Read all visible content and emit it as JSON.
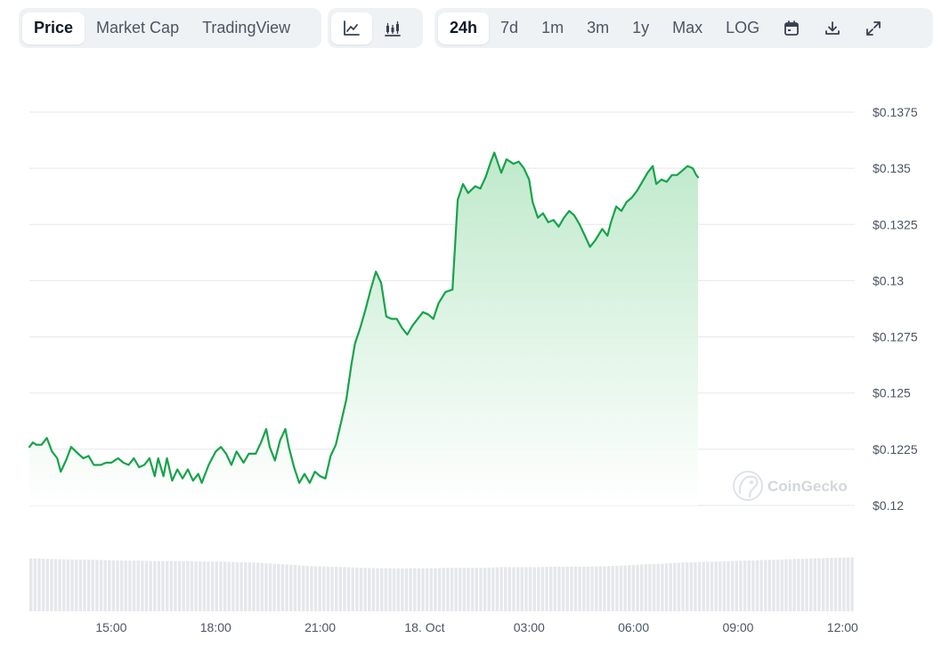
{
  "toolbar": {
    "view_tabs": [
      {
        "label": "Price",
        "active": true
      },
      {
        "label": "Market Cap",
        "active": false
      },
      {
        "label": "TradingView",
        "active": false
      }
    ],
    "chart_type_icons": [
      "line-chart-icon",
      "candlestick-chart-icon"
    ],
    "range_tabs": [
      {
        "label": "24h",
        "active": true
      },
      {
        "label": "7d",
        "active": false
      },
      {
        "label": "1m",
        "active": false
      },
      {
        "label": "3m",
        "active": false
      },
      {
        "label": "1y",
        "active": false
      },
      {
        "label": "Max",
        "active": false
      },
      {
        "label": "LOG",
        "active": false
      }
    ],
    "action_icons": [
      "calendar-icon",
      "download-icon",
      "expand-icon"
    ]
  },
  "watermark": "CoinGecko",
  "colors": {
    "line": "#16a34a",
    "fill_top": "#bbe8c8",
    "fill_bottom": "#ffffff",
    "grid": "#e5e7eb",
    "volume": "#e5e7eb"
  },
  "chart_data": {
    "type": "area",
    "x_unit": "hours since 12:00 (17 Oct)",
    "xlim": [
      0.65,
      24.35
    ],
    "ylim": [
      0.12,
      0.1375
    ],
    "y_ticks": [
      0.12,
      0.1225,
      0.125,
      0.1275,
      0.13,
      0.1325,
      0.135,
      0.1375
    ],
    "y_tick_labels": [
      "$0.12",
      "$0.1225",
      "$0.125",
      "$0.1275",
      "$0.13",
      "$0.1325",
      "$0.135",
      "$0.1375"
    ],
    "x_ticks": [
      3,
      6,
      9,
      12,
      15,
      18,
      21,
      24
    ],
    "x_tick_labels": [
      "15:00",
      "18:00",
      "21:00",
      "18. Oct",
      "03:00",
      "06:00",
      "09:00",
      "12:00"
    ],
    "grid": true,
    "series": [
      {
        "name": "",
        "points": [
          [
            0.65,
            0.1226
          ],
          [
            0.75,
            0.1228
          ],
          [
            0.85,
            0.1227
          ],
          [
            1.0,
            0.1227
          ],
          [
            1.15,
            0.123
          ],
          [
            1.3,
            0.1224
          ],
          [
            1.45,
            0.1221
          ],
          [
            1.55,
            0.1215
          ],
          [
            1.7,
            0.122
          ],
          [
            1.85,
            0.1226
          ],
          [
            2.05,
            0.1223
          ],
          [
            2.2,
            0.1221
          ],
          [
            2.35,
            0.1222
          ],
          [
            2.5,
            0.1218
          ],
          [
            2.7,
            0.1218
          ],
          [
            2.85,
            0.1219
          ],
          [
            3.0,
            0.1219
          ],
          [
            3.2,
            0.1221
          ],
          [
            3.35,
            0.1219
          ],
          [
            3.5,
            0.1218
          ],
          [
            3.65,
            0.1221
          ],
          [
            3.8,
            0.1217
          ],
          [
            3.95,
            0.1218
          ],
          [
            4.1,
            0.1221
          ],
          [
            4.25,
            0.1213
          ],
          [
            4.35,
            0.1221
          ],
          [
            4.5,
            0.1213
          ],
          [
            4.6,
            0.1221
          ],
          [
            4.75,
            0.1211
          ],
          [
            4.9,
            0.1216
          ],
          [
            5.05,
            0.1212
          ],
          [
            5.2,
            0.1216
          ],
          [
            5.35,
            0.1211
          ],
          [
            5.5,
            0.1214
          ],
          [
            5.6,
            0.121
          ],
          [
            5.8,
            0.1218
          ],
          [
            6.0,
            0.1224
          ],
          [
            6.15,
            0.1226
          ],
          [
            6.3,
            0.1223
          ],
          [
            6.45,
            0.1218
          ],
          [
            6.6,
            0.1224
          ],
          [
            6.8,
            0.1219
          ],
          [
            6.95,
            0.1223
          ],
          [
            7.15,
            0.1223
          ],
          [
            7.3,
            0.1228
          ],
          [
            7.45,
            0.1234
          ],
          [
            7.55,
            0.1226
          ],
          [
            7.7,
            0.122
          ],
          [
            7.85,
            0.1229
          ],
          [
            8.0,
            0.1234
          ],
          [
            8.1,
            0.1226
          ],
          [
            8.25,
            0.1217
          ],
          [
            8.4,
            0.121
          ],
          [
            8.55,
            0.1214
          ],
          [
            8.7,
            0.121
          ],
          [
            8.85,
            0.1215
          ],
          [
            9.0,
            0.1213
          ],
          [
            9.15,
            0.1212
          ],
          [
            9.3,
            0.1222
          ],
          [
            9.45,
            0.1227
          ],
          [
            9.6,
            0.1237
          ],
          [
            9.75,
            0.1247
          ],
          [
            9.9,
            0.1263
          ],
          [
            10.0,
            0.1272
          ],
          [
            10.15,
            0.1279
          ],
          [
            10.3,
            0.1287
          ],
          [
            10.45,
            0.1296
          ],
          [
            10.6,
            0.1304
          ],
          [
            10.75,
            0.1299
          ],
          [
            10.9,
            0.1284
          ],
          [
            11.05,
            0.1283
          ],
          [
            11.2,
            0.1283
          ],
          [
            11.35,
            0.1279
          ],
          [
            11.5,
            0.1276
          ],
          [
            11.65,
            0.128
          ],
          [
            11.8,
            0.1283
          ],
          [
            11.95,
            0.1286
          ],
          [
            12.1,
            0.1285
          ],
          [
            12.25,
            0.1283
          ],
          [
            12.4,
            0.129
          ],
          [
            12.6,
            0.1295
          ],
          [
            12.8,
            0.1296
          ],
          [
            12.95,
            0.1336
          ],
          [
            13.1,
            0.1343
          ],
          [
            13.25,
            0.1339
          ],
          [
            13.45,
            0.1342
          ],
          [
            13.6,
            0.1341
          ],
          [
            13.75,
            0.1346
          ],
          [
            13.9,
            0.1353
          ],
          [
            14.0,
            0.1357
          ],
          [
            14.2,
            0.1348
          ],
          [
            14.35,
            0.1354
          ],
          [
            14.55,
            0.1352
          ],
          [
            14.7,
            0.1353
          ],
          [
            14.85,
            0.135
          ],
          [
            15.0,
            0.1345
          ],
          [
            15.1,
            0.1335
          ],
          [
            15.25,
            0.1328
          ],
          [
            15.4,
            0.133
          ],
          [
            15.55,
            0.1326
          ],
          [
            15.7,
            0.1327
          ],
          [
            15.85,
            0.1324
          ],
          [
            16.0,
            0.1328
          ],
          [
            16.15,
            0.1331
          ],
          [
            16.3,
            0.1329
          ],
          [
            16.45,
            0.1325
          ],
          [
            16.6,
            0.132
          ],
          [
            16.75,
            0.1315
          ],
          [
            16.9,
            0.1318
          ],
          [
            17.1,
            0.1323
          ],
          [
            17.25,
            0.132
          ],
          [
            17.35,
            0.1326
          ],
          [
            17.5,
            0.1333
          ],
          [
            17.65,
            0.1331
          ],
          [
            17.8,
            0.1335
          ],
          [
            17.95,
            0.1337
          ],
          [
            18.1,
            0.134
          ],
          [
            18.25,
            0.1344
          ],
          [
            18.4,
            0.1348
          ],
          [
            18.55,
            0.1351
          ],
          [
            18.65,
            0.1343
          ],
          [
            18.8,
            0.1345
          ],
          [
            18.95,
            0.1344
          ],
          [
            19.1,
            0.1347
          ],
          [
            19.25,
            0.1347
          ],
          [
            19.4,
            0.1349
          ],
          [
            19.55,
            0.1351
          ],
          [
            19.7,
            0.135
          ],
          [
            19.8,
            0.1347
          ],
          [
            19.85,
            0.1346
          ]
        ]
      }
    ],
    "volume": {
      "note": "relative volume bars along the bottom",
      "values": [
        0.96,
        0.95,
        0.94,
        0.94,
        0.93,
        0.92,
        0.92,
        0.91,
        0.91,
        0.91,
        0.9,
        0.9,
        0.89,
        0.88,
        0.86,
        0.84,
        0.82,
        0.81,
        0.8,
        0.79,
        0.78,
        0.78,
        0.78,
        0.78,
        0.79,
        0.79,
        0.79,
        0.8,
        0.8,
        0.8,
        0.81,
        0.81,
        0.81,
        0.82,
        0.83,
        0.85,
        0.86,
        0.88,
        0.89,
        0.9,
        0.91,
        0.92,
        0.93,
        0.94,
        0.95,
        0.96,
        0.97,
        0.98
      ]
    }
  }
}
